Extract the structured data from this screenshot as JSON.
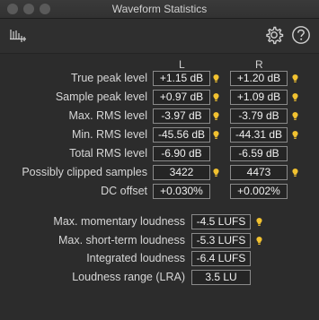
{
  "window": {
    "title": "Waveform Statistics"
  },
  "toolbar": {
    "logo_icon": "waveform-stats-icon",
    "settings_icon": "gear-icon",
    "help_icon": "help-icon"
  },
  "columns": {
    "left": "L",
    "right": "R"
  },
  "rows": [
    {
      "label": "True peak level",
      "left": "+1.15 dB",
      "right": "+1.20 dB",
      "left_warn": true,
      "right_warn": true
    },
    {
      "label": "Sample peak level",
      "left": "+0.97 dB",
      "right": "+1.09 dB",
      "left_warn": true,
      "right_warn": true
    },
    {
      "label": "Max. RMS level",
      "left": "-3.97 dB",
      "right": "-3.79 dB",
      "left_warn": true,
      "right_warn": true
    },
    {
      "label": "Min. RMS level",
      "left": "-45.56 dB",
      "right": "-44.31 dB",
      "left_warn": true,
      "right_warn": true
    },
    {
      "label": "Total RMS level",
      "left": "-6.90 dB",
      "right": "-6.59 dB",
      "left_warn": false,
      "right_warn": false
    },
    {
      "label": "Possibly clipped samples",
      "left": "3422",
      "right": "4473",
      "left_warn": true,
      "right_warn": true
    },
    {
      "label": "DC offset",
      "left": "+0.030%",
      "right": "+0.002%",
      "left_warn": false,
      "right_warn": false
    }
  ],
  "loudness": [
    {
      "label": "Max. momentary loudness",
      "value": "-4.5 LUFS",
      "warn": true
    },
    {
      "label": "Max. short-term loudness",
      "value": "-5.3 LUFS",
      "warn": true
    },
    {
      "label": "Integrated loudness",
      "value": "-6.4 LUFS",
      "warn": false
    },
    {
      "label": "Loudness range (LRA)",
      "value": "3.5 LU",
      "warn": false
    }
  ],
  "colors": {
    "warning": "#f2c230",
    "background": "#2c2c2c"
  }
}
